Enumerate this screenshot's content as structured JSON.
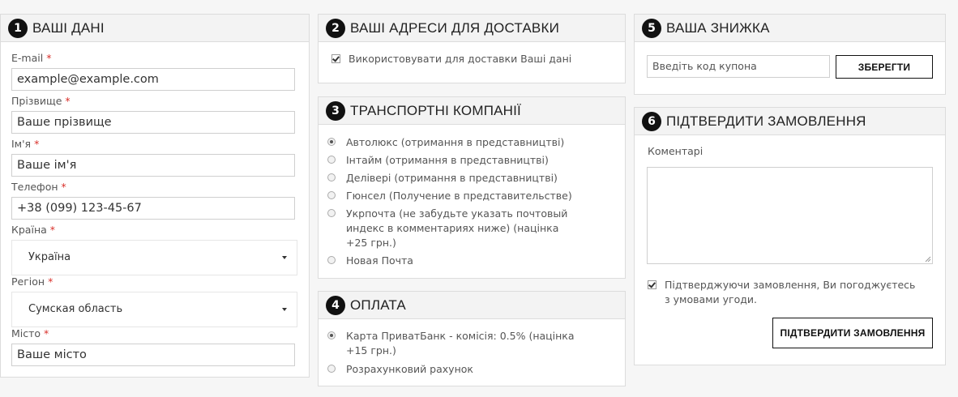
{
  "personal": {
    "number": "1",
    "title": "ВАШІ ДАНІ",
    "required_mark": "*",
    "email": {
      "label": "E-mail",
      "value": "example@example.com"
    },
    "surname": {
      "label": "Прізвище",
      "value": "Ваше прізвище"
    },
    "name": {
      "label": "Ім'я",
      "value": "Ваше ім'я"
    },
    "phone": {
      "label": "Телефон",
      "value": "+38 (099) 123-45-67"
    },
    "country": {
      "label": "Країна",
      "value": "Україна"
    },
    "region": {
      "label": "Регіон",
      "value": "Сумская область"
    },
    "city": {
      "label": "Місто",
      "value": "Ваше місто"
    }
  },
  "delivery_address": {
    "number": "2",
    "title": "ВАШІ АДРЕСИ ДЛЯ ДОСТАВКИ",
    "use_personal": {
      "label": "Використовувати для доставки Ваші дані",
      "checked": true
    }
  },
  "transport": {
    "number": "3",
    "title": "ТРАНСПОРТНІ КОМПАНІЇ",
    "options": [
      {
        "label": "Автолюкс (отримання в представництві)",
        "selected": true
      },
      {
        "label": "Інтайм (отримання в представництві)",
        "selected": false
      },
      {
        "label": "Делівері (отримання в представництві)",
        "selected": false
      },
      {
        "label": "Гюнсел (Получение в представительстве)",
        "selected": false
      },
      {
        "label": "Укрпочта (не забудьте указать почтовый индекс в комментариях ниже)  (націнка +25 грн.)",
        "selected": false
      },
      {
        "label": "Новая Почта",
        "selected": false
      }
    ]
  },
  "payment": {
    "number": "4",
    "title": "ОПЛАТА",
    "options": [
      {
        "label": "Карта ПриватБанк - комісія: 0.5%  (націнка +15 грн.)",
        "selected": true
      },
      {
        "label": "Розрахунковий рахунок",
        "selected": false
      }
    ]
  },
  "discount": {
    "number": "5",
    "title": "ВАША ЗНИЖКА",
    "coupon_placeholder": "Введіть код купона",
    "save_label": "ЗБЕРЕГТИ"
  },
  "confirm": {
    "number": "6",
    "title": "ПІДТВЕРДИТИ ЗАМОВЛЕННЯ",
    "comments_label": "Коментарі",
    "comments_value": "",
    "agree_label": "Підтверджуючи замовлення, Ви погоджуєтесь з умовами угоди.",
    "agree_checked": true,
    "submit_label": "ПІДТВЕРДИТИ ЗАМОВЛЕННЯ"
  }
}
